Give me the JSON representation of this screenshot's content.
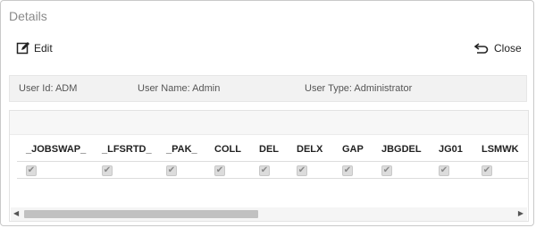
{
  "dialog": {
    "title": "Details"
  },
  "toolbar": {
    "edit_label": "Edit",
    "close_label": "Close"
  },
  "info": {
    "user_id": "User Id: ADM",
    "user_name": "User Name: Admin",
    "user_type": "User Type: Administrator"
  },
  "grid": {
    "columns": [
      "_JOBSWAP_",
      "_LFSRTD_",
      "_PAK_",
      "COLL",
      "DEL",
      "DELX",
      "GAP",
      "JBGDEL",
      "JG01",
      "LSMWK"
    ],
    "row": {
      "checked": [
        true,
        true,
        true,
        true,
        true,
        true,
        true,
        true,
        true,
        true
      ],
      "check_glyph": "✔"
    }
  },
  "icons": {
    "edit": "edit-icon",
    "close": "return-arrow-icon",
    "scroll_left": "scroll-left-arrow-icon",
    "scroll_right": "scroll-right-arrow-icon"
  }
}
